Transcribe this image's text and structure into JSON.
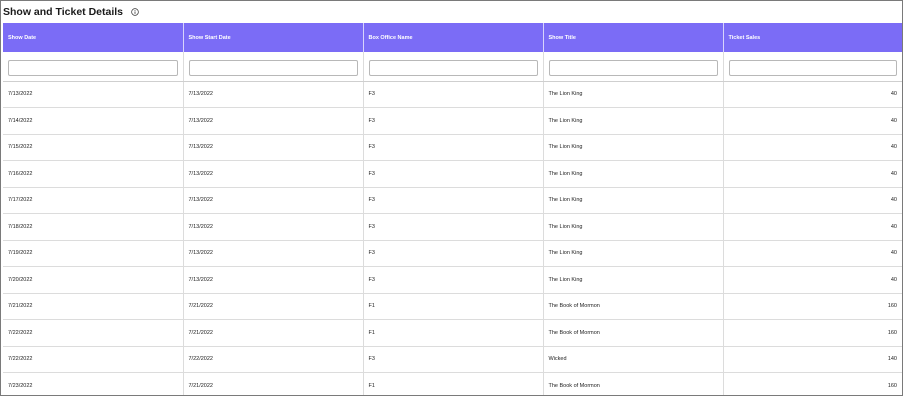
{
  "header": {
    "title": "Show and Ticket Details",
    "info_icon": "info-circle-icon"
  },
  "table": {
    "columns": [
      "Show Date",
      "Show Start Date",
      "Box Office Name",
      "Show Title",
      "Ticket Sales"
    ],
    "filters": [
      {
        "value": "",
        "placeholder": ""
      },
      {
        "value": "",
        "placeholder": ""
      },
      {
        "value": "",
        "placeholder": ""
      },
      {
        "value": "",
        "placeholder": ""
      },
      {
        "value": "",
        "placeholder": ""
      }
    ],
    "rows": [
      [
        "7/13/2022",
        "7/13/2022",
        "F3",
        "The Lion King",
        "40"
      ],
      [
        "7/14/2022",
        "7/13/2022",
        "F3",
        "The Lion King",
        "40"
      ],
      [
        "7/15/2022",
        "7/13/2022",
        "F3",
        "The Lion King",
        "40"
      ],
      [
        "7/16/2022",
        "7/13/2022",
        "F3",
        "The Lion King",
        "40"
      ],
      [
        "7/17/2022",
        "7/13/2022",
        "F3",
        "The Lion King",
        "40"
      ],
      [
        "7/18/2022",
        "7/13/2022",
        "F3",
        "The Lion King",
        "40"
      ],
      [
        "7/19/2022",
        "7/13/2022",
        "F3",
        "The Lion King",
        "40"
      ],
      [
        "7/20/2022",
        "7/13/2022",
        "F3",
        "The Lion King",
        "40"
      ],
      [
        "7/21/2022",
        "7/21/2022",
        "F1",
        "The Book of Mormon",
        "160"
      ],
      [
        "7/22/2022",
        "7/21/2022",
        "F1",
        "The Book of Mormon",
        "160"
      ],
      [
        "7/22/2022",
        "7/22/2022",
        "F3",
        "Wicked",
        "140"
      ],
      [
        "7/23/2022",
        "7/21/2022",
        "F1",
        "The Book of Mormon",
        "160"
      ]
    ]
  },
  "colors": {
    "header_bg": "#7b6cf6",
    "header_text": "#ffffff",
    "grid_line": "#dcdcdc",
    "frame_border": "#7a7a7a"
  }
}
